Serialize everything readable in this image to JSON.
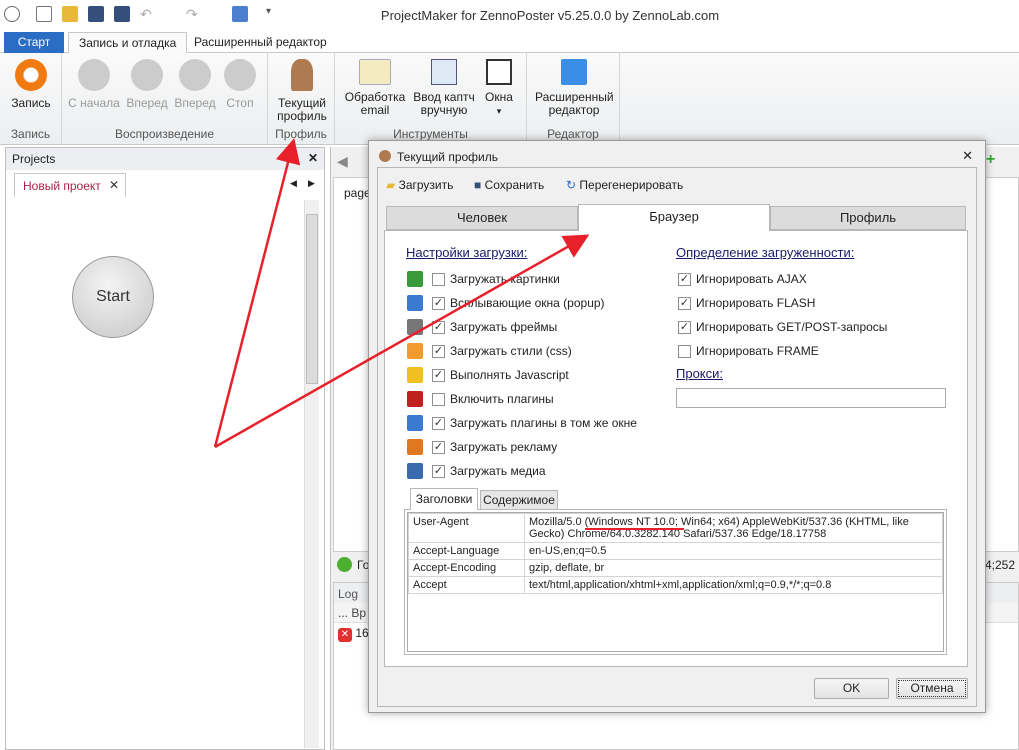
{
  "window": {
    "title": "ProjectMaker for ZennoPoster v5.25.0.0 by ZennoLab.com"
  },
  "tabs": [
    {
      "label": "Старт"
    },
    {
      "label": "Запись и отладка"
    },
    {
      "label": "Расширенный редактор"
    }
  ],
  "ribbon": {
    "groups": [
      "Запись",
      "Воспроизведение",
      "Профиль",
      "Инструменты",
      "Редактор"
    ],
    "buttons": {
      "record": "Запись",
      "from_start": "С начала",
      "forward": "Вперед",
      "forward2": "Вперед",
      "stop": "Стоп",
      "profile": [
        "Текущий",
        "профиль"
      ],
      "email": [
        "Обработка",
        "email"
      ],
      "captcha": [
        "Ввод каптч",
        "вручную"
      ],
      "windows": "Окна",
      "editor": [
        "Расширенный",
        "редактор"
      ]
    }
  },
  "projects": {
    "title": "Projects",
    "tab": "Новый проект",
    "start": "Start"
  },
  "workspace": {
    "page_tab": "page",
    "status": "Готово",
    "coords": "14;252",
    "log_title": "Log",
    "col_dots": "...",
    "col_time": "Вр",
    "row_time": "16"
  },
  "dialog": {
    "title": "Текущий профиль",
    "toolbar": {
      "load": "Загрузить",
      "save": "Сохранить",
      "regen": "Перегенерировать"
    },
    "tabs": [
      "Человек",
      "Браузер",
      "Профиль"
    ],
    "load_settings": {
      "title": "Настройки загрузки:",
      "items": [
        {
          "label": "Загружать картинки",
          "checked": false,
          "icon": "image-icon"
        },
        {
          "label": "Всплывающие окна (popup)",
          "checked": true,
          "icon": "popup-icon"
        },
        {
          "label": "Загружать фреймы",
          "checked": true,
          "icon": "frame-icon"
        },
        {
          "label": "Загружать стили (css)",
          "checked": true,
          "icon": "css-icon"
        },
        {
          "label": "Выполнять Javascript",
          "checked": true,
          "icon": "lightning-icon"
        },
        {
          "label": "Включить плагины",
          "checked": false,
          "icon": "flash-icon"
        },
        {
          "label": "Загружать плагины в том же окне",
          "checked": true,
          "icon": "plugin-window-icon"
        },
        {
          "label": "Загружать рекламу",
          "checked": true,
          "icon": "ad-icon"
        },
        {
          "label": "Загружать медиа",
          "checked": true,
          "icon": "music-icon"
        }
      ]
    },
    "busy": {
      "title": "Определение загруженности:",
      "items": [
        {
          "label": "Игнорировать AJAX",
          "checked": true
        },
        {
          "label": "Игнорировать FLASH",
          "checked": true
        },
        {
          "label": "Игнорировать GET/POST-запросы",
          "checked": true
        },
        {
          "label": "Игнорировать FRAME",
          "checked": false
        }
      ]
    },
    "proxy": {
      "label": "Прокси:",
      "value": ""
    },
    "inner_tabs": [
      "Заголовки",
      "Содержимое"
    ],
    "headers": [
      {
        "name": "User-Agent",
        "value": "Mozilla/5.0 (Windows NT 10.0; Win64; x64) AppleWebKit/537.36 (KHTML, like Gecko) Chrome/64.0.3282.140 Safari/537.36 Edge/18.17758"
      },
      {
        "name": "Accept-Language",
        "value": "en-US,en;q=0.5"
      },
      {
        "name": "Accept-Encoding",
        "value": "gzip, deflate, br"
      },
      {
        "name": "Accept",
        "value": "text/html,application/xhtml+xml,application/xml;q=0.9,*/*;q=0.8"
      }
    ],
    "ok": "OK",
    "cancel": "Отмена"
  },
  "colors": {
    "accent": "#2b6cc4",
    "annotation": "#e8202a"
  }
}
